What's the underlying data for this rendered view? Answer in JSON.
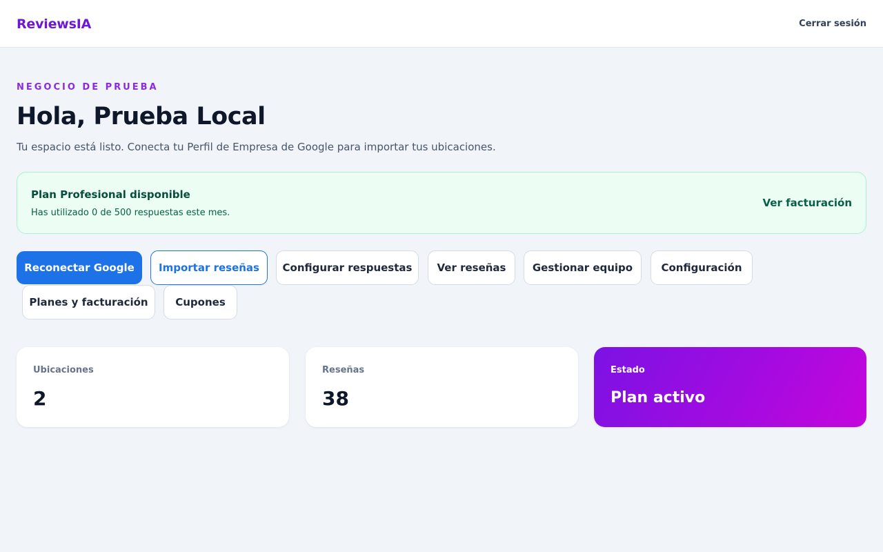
{
  "header": {
    "brand": "ReviewsIA",
    "logout_label": "Cerrar sesión"
  },
  "hero": {
    "eyebrow": "NEGOCIO DE PRUEBA",
    "greeting": "Hola, Prueba Local",
    "subtitle": "Tu espacio está listo. Conecta tu Perfil de Empresa de Google para importar tus ubicaciones."
  },
  "plan_banner": {
    "title": "Plan Profesional disponible",
    "usage": "Has utilizado 0 de 500 respuestas este mes.",
    "link_label": "Ver facturación"
  },
  "actions": {
    "reconnect_google": "Reconectar Google",
    "import_reviews": "Importar reseñas",
    "configure_replies": "Configurar respuestas",
    "view_reviews": "Ver reseñas",
    "manage_team": "Gestionar equipo",
    "settings": "Configuración",
    "plans_billing": "Planes y facturación",
    "coupons": "Cupones"
  },
  "stats": {
    "locations": {
      "label": "Ubicaciones",
      "value": "2"
    },
    "reviews": {
      "label": "Reseñas",
      "value": "38"
    },
    "status": {
      "label": "Estado",
      "value": "Plan activo"
    }
  },
  "colors": {
    "brand": "#6d18d6",
    "primary": "#1d72e8",
    "success_bg": "#ecfdf4",
    "status_gradient_start": "#7c12e4",
    "status_gradient_end": "#c406dc"
  }
}
